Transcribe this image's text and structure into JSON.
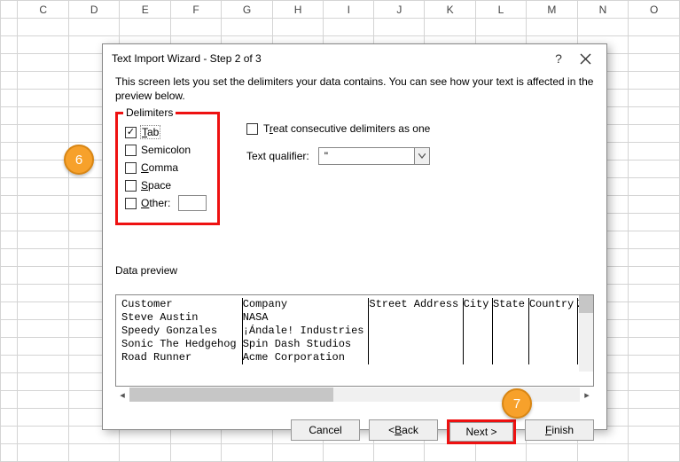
{
  "columns": [
    "C",
    "D",
    "E",
    "F",
    "G",
    "H",
    "I",
    "J",
    "K",
    "L",
    "M",
    "N",
    "O"
  ],
  "rows": [
    "",
    "",
    "",
    "",
    "",
    "",
    "",
    "",
    "",
    "",
    "",
    "",
    "",
    "",
    "",
    "",
    "",
    "",
    "",
    "",
    "",
    "",
    "",
    "",
    ""
  ],
  "dialog": {
    "title": "Text Import Wizard - Step 2 of 3",
    "help": "?",
    "description": "This screen lets you set the delimiters your data contains.  You can see how your text is affected in the preview below.",
    "delimiters": {
      "legend": "Delimiters",
      "items": [
        {
          "label": "Tab",
          "u": "T",
          "checked": true,
          "focused": true
        },
        {
          "label": "Semicolon",
          "u": "",
          "checked": false
        },
        {
          "label": "Comma",
          "u": "C",
          "checked": false
        },
        {
          "label": "Space",
          "u": "S",
          "checked": false
        },
        {
          "label": "Other:",
          "u": "O",
          "checked": false,
          "hasInput": true
        }
      ]
    },
    "treat": {
      "label": "Treat consecutive delimiters as one",
      "u": "r",
      "checked": false
    },
    "qualifier": {
      "label": "Text qualifier:",
      "u": "q",
      "value": "\""
    },
    "preview_label": "Data preview",
    "preview": {
      "headers": [
        "Customer",
        "Company",
        "Street Address",
        "City",
        "State",
        "Country",
        "Zi"
      ],
      "rows": [
        [
          "Steve Austin",
          "NASA",
          "",
          "",
          "",
          "",
          ""
        ],
        [
          "Speedy Gonzales",
          "¡Ándale! Industries",
          "",
          "",
          "",
          "",
          ""
        ],
        [
          "Sonic The Hedgehog",
          "Spin Dash Studios",
          "",
          "",
          "",
          "",
          ""
        ],
        [
          "Road Runner",
          "Acme Corporation",
          "",
          "",
          "",
          "",
          ""
        ]
      ]
    },
    "buttons": {
      "cancel": "Cancel",
      "back": "< Back",
      "next": "Next >",
      "finish": "Finish"
    }
  },
  "callouts": {
    "six": "6",
    "seven": "7"
  }
}
